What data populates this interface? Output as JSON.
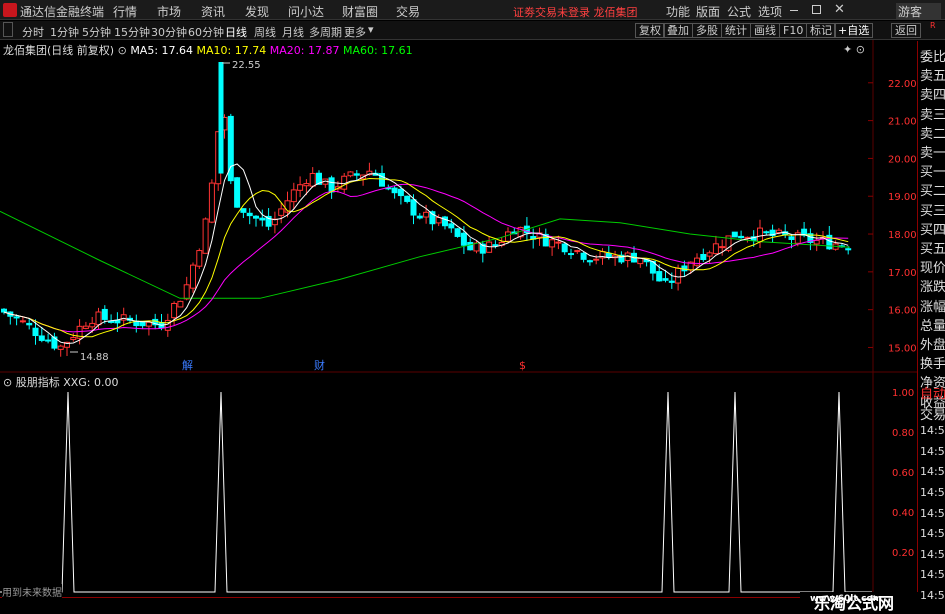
{
  "menubar": {
    "app_title": "通达信金融终端",
    "items": [
      "行情",
      "市场",
      "资讯",
      "发现",
      "问小达",
      "财富圈",
      "交易"
    ],
    "notice": "证劵交易未登录  龙佰集团",
    "right_items": [
      "功能",
      "版面",
      "公式",
      "选项"
    ],
    "guest": "游客"
  },
  "tabbar": {
    "periods": [
      "分时",
      "1分钟",
      "5分钟",
      "15分钟",
      "30分钟",
      "60分钟",
      "日线",
      "周线",
      "月线",
      "多周期",
      "更多"
    ],
    "active": "日线",
    "right_buttons": [
      "复权",
      "叠加",
      "多股",
      "统计",
      "画线",
      "F10",
      "标记",
      "+自选",
      "返回"
    ]
  },
  "main_chart": {
    "stock_label": "龙佰集团(日线 前复权)",
    "ma": [
      {
        "label": "MA5: 17.64",
        "color": "#ffffff"
      },
      {
        "label": "MA10: 17.74",
        "color": "#ffff00"
      },
      {
        "label": "MA20: 17.87",
        "color": "#ff00ff"
      },
      {
        "label": "MA60: 17.61",
        "color": "#00ff00"
      }
    ],
    "y_ticks": [
      "22.00",
      "21.00",
      "20.00",
      "19.00",
      "18.00",
      "17.00",
      "16.00",
      "15.00"
    ],
    "high_label": "22.55",
    "low_label": "14.88",
    "event_markers": [
      "解",
      "财",
      "$"
    ]
  },
  "indicator": {
    "label": "股朋指标  XXG: 0.00",
    "y_ticks": [
      "1.00",
      "0.80",
      "0.60",
      "0.40",
      "0.20"
    ]
  },
  "x_axis": {
    "labels": [
      "2024年",
      "9",
      "10",
      "11",
      "12",
      "1",
      "2"
    ]
  },
  "footer_text": "用到未来数据",
  "right_panel": {
    "top_label": "R",
    "top_value": "300",
    "items": [
      "委比",
      "卖五",
      "卖四",
      "卖三",
      "卖二",
      "卖一",
      "买一",
      "买二",
      "买三",
      "买四",
      "买五",
      "现价",
      "涨跌",
      "涨幅",
      "总量",
      "外盘",
      "换手",
      "净资",
      "收益"
    ],
    "lower_items": [
      "自动",
      "交易",
      "14:56",
      "14:56",
      "14:56",
      "14:56",
      "14:56",
      "14:56",
      "14:56",
      "14:56",
      "14:56"
    ]
  },
  "watermark": {
    "line1": "乐淘公式网",
    "line2": "www.60lt.com"
  },
  "colors": {
    "up": "#ff3333",
    "down": "#00ffff",
    "ma5": "#ffffff",
    "ma10": "#ffff00",
    "ma20": "#ff00ff",
    "ma60": "#00cc00",
    "grid": "#8b0000"
  }
}
